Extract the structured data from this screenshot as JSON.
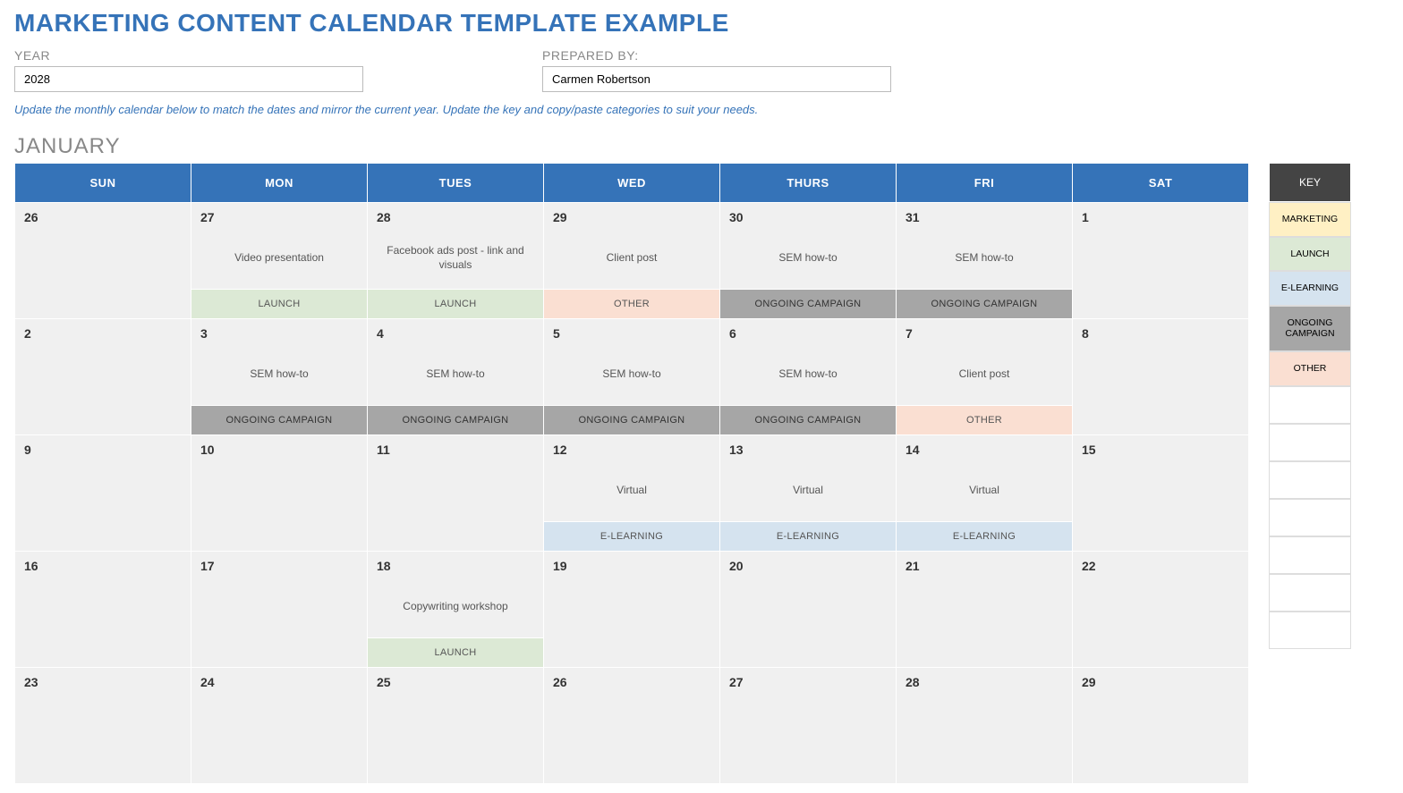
{
  "title": "MARKETING CONTENT CALENDAR TEMPLATE EXAMPLE",
  "meta": {
    "year_label": "YEAR",
    "year_value": "2028",
    "prepared_label": "PREPARED BY:",
    "prepared_value": "Carmen Robertson"
  },
  "instructions": "Update the monthly calendar below to match the dates and mirror the current year. Update the key and copy/paste categories to suit your needs.",
  "month": "JANUARY",
  "day_headers": [
    "SUN",
    "MON",
    "TUES",
    "WED",
    "THURS",
    "FRI",
    "SAT"
  ],
  "weeks": [
    [
      {
        "num": "26"
      },
      {
        "num": "27",
        "event": "Video presentation",
        "tag": "LAUNCH",
        "tag_class": "launch"
      },
      {
        "num": "28",
        "event": "Facebook ads post - link and visuals",
        "tag": "LAUNCH",
        "tag_class": "launch"
      },
      {
        "num": "29",
        "event": "Client post",
        "tag": "OTHER",
        "tag_class": "other"
      },
      {
        "num": "30",
        "event": "SEM how-to",
        "tag": "ONGOING CAMPAIGN",
        "tag_class": "ongoing"
      },
      {
        "num": "31",
        "event": "SEM how-to",
        "tag": "ONGOING CAMPAIGN",
        "tag_class": "ongoing"
      },
      {
        "num": "1"
      }
    ],
    [
      {
        "num": "2"
      },
      {
        "num": "3",
        "event": "SEM how-to",
        "tag": "ONGOING CAMPAIGN",
        "tag_class": "ongoing"
      },
      {
        "num": "4",
        "event": "SEM how-to",
        "tag": "ONGOING CAMPAIGN",
        "tag_class": "ongoing"
      },
      {
        "num": "5",
        "event": "SEM how-to",
        "tag": "ONGOING CAMPAIGN",
        "tag_class": "ongoing"
      },
      {
        "num": "6",
        "event": "SEM how-to",
        "tag": "ONGOING CAMPAIGN",
        "tag_class": "ongoing"
      },
      {
        "num": "7",
        "event": "Client post",
        "tag": "OTHER",
        "tag_class": "other"
      },
      {
        "num": "8"
      }
    ],
    [
      {
        "num": "9"
      },
      {
        "num": "10"
      },
      {
        "num": "11"
      },
      {
        "num": "12",
        "event": "Virtual",
        "tag": "E-LEARNING",
        "tag_class": "elearning"
      },
      {
        "num": "13",
        "event": "Virtual",
        "tag": "E-LEARNING",
        "tag_class": "elearning"
      },
      {
        "num": "14",
        "event": "Virtual",
        "tag": "E-LEARNING",
        "tag_class": "elearning"
      },
      {
        "num": "15"
      }
    ],
    [
      {
        "num": "16"
      },
      {
        "num": "17"
      },
      {
        "num": "18",
        "event": "Copywriting workshop",
        "tag": "LAUNCH",
        "tag_class": "launch"
      },
      {
        "num": "19"
      },
      {
        "num": "20"
      },
      {
        "num": "21"
      },
      {
        "num": "22"
      }
    ],
    [
      {
        "num": "23"
      },
      {
        "num": "24"
      },
      {
        "num": "25"
      },
      {
        "num": "26"
      },
      {
        "num": "27"
      },
      {
        "num": "28"
      },
      {
        "num": "29"
      }
    ]
  ],
  "key": {
    "header": "KEY",
    "items": [
      {
        "label": "MARKETING",
        "class": "marketing"
      },
      {
        "label": "LAUNCH",
        "class": "launch"
      },
      {
        "label": "E-LEARNING",
        "class": "elearning"
      },
      {
        "label": "ONGOING CAMPAIGN",
        "class": "ongoing"
      },
      {
        "label": "OTHER",
        "class": "other"
      }
    ],
    "blanks": 7
  }
}
